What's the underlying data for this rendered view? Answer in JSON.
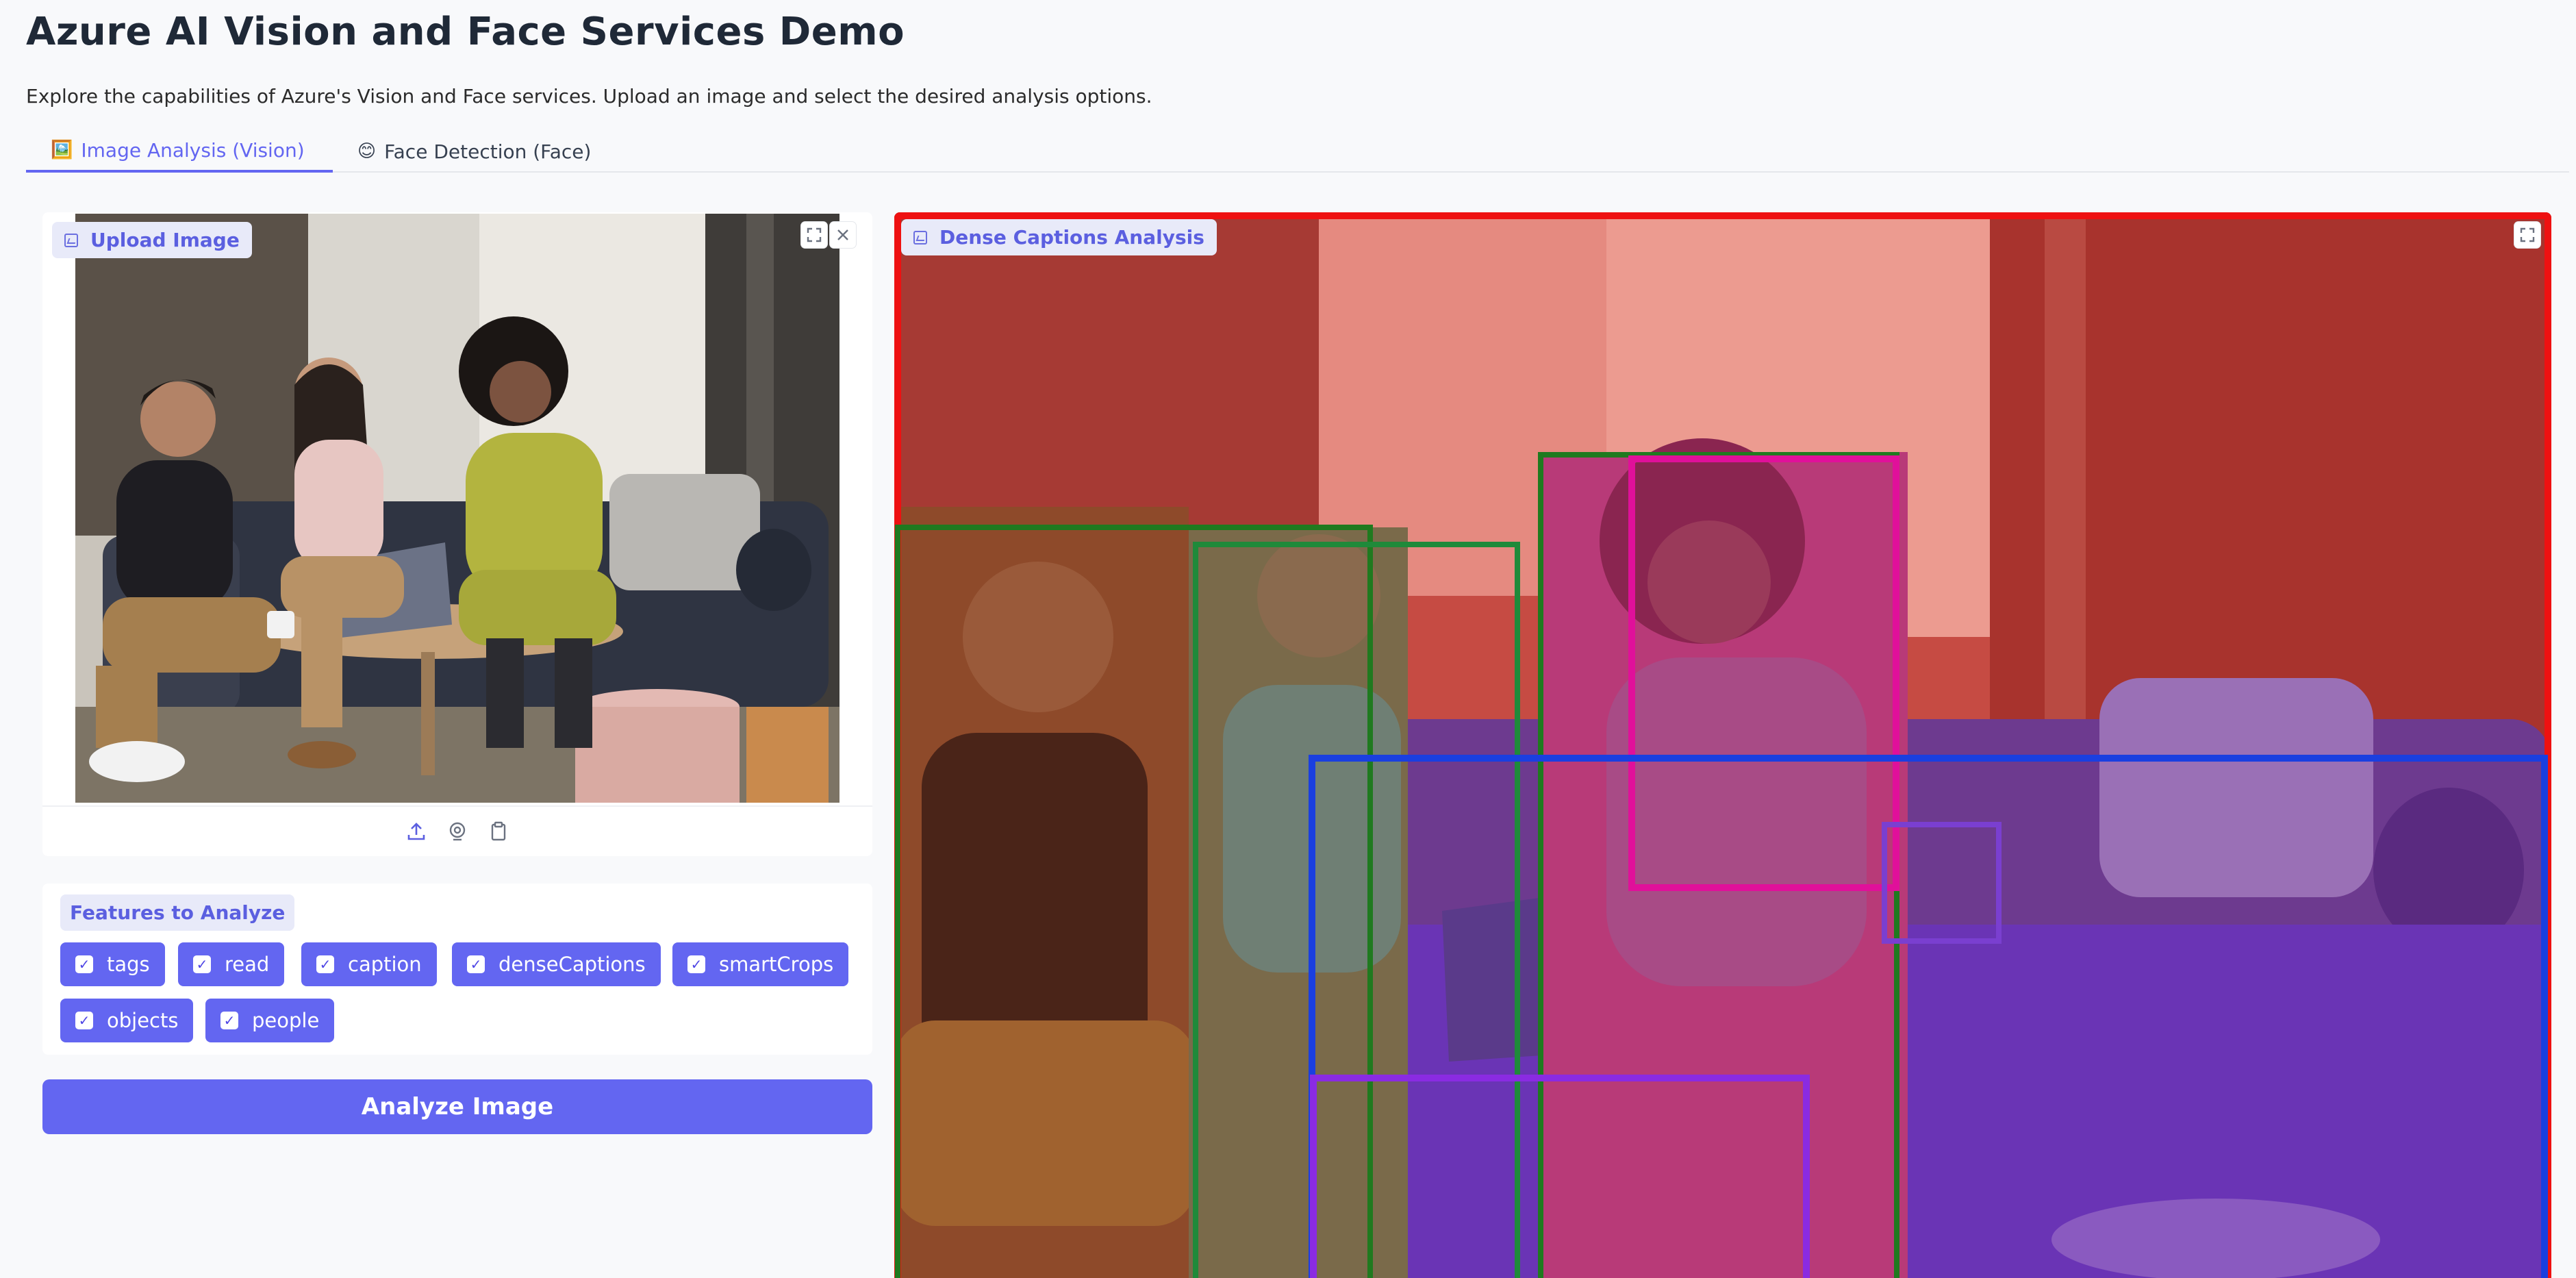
{
  "page": {
    "title": "Azure AI Vision and Face Services Demo",
    "description": "Explore the capabilities of Azure's Vision and Face services. Upload an image and select the desired analysis options."
  },
  "tabs": [
    {
      "icon": "picture-icon",
      "emoji": "🖼️",
      "label": "Image Analysis (Vision)",
      "active": true
    },
    {
      "icon": "smiley-icon",
      "emoji": "😊",
      "label": "Face Detection (Face)",
      "active": false
    }
  ],
  "upload": {
    "label": "Upload Image",
    "toolbar": [
      "upload-icon",
      "webcam-icon",
      "clipboard-icon"
    ]
  },
  "features": {
    "label": "Features to Analyze",
    "options": [
      {
        "label": "tags",
        "checked": true
      },
      {
        "label": "read",
        "checked": true
      },
      {
        "label": "caption",
        "checked": true
      },
      {
        "label": "denseCaptions",
        "checked": true
      },
      {
        "label": "smartCrops",
        "checked": true
      },
      {
        "label": "objects",
        "checked": true
      },
      {
        "label": "people",
        "checked": true
      }
    ]
  },
  "analyze_button": {
    "label": "Analyze Image"
  },
  "result": {
    "label": "Dense Captions Analysis",
    "box_colors": [
      "#ee1111",
      "#1f7a1f",
      "#e0109a",
      "#1a3fe0",
      "#8a2be2",
      "#7a3fd0"
    ]
  },
  "colors": {
    "accent": "#6366f1",
    "label_bg": "#e8eaf9",
    "background": "#f8f9fb"
  }
}
